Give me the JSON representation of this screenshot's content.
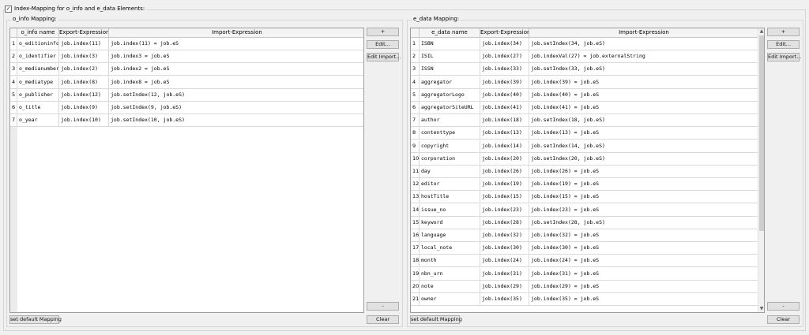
{
  "outer": {
    "title": "Index-Mapping for o_info and e_data Elements:",
    "checked": "✓"
  },
  "o_info": {
    "title": "o_info Mapping:",
    "headers": [
      "o_info name",
      "Export-Expression",
      "Import-Expression"
    ],
    "rows": [
      {
        "n": "1",
        "name": "o_editioninfo",
        "exp": "job.index(11)",
        "imp": "job.index(11) = job.eS"
      },
      {
        "n": "2",
        "name": "o_identifier",
        "exp": "job.index(3)",
        "imp": "job.index3 = job.eS"
      },
      {
        "n": "3",
        "name": "o_medianumber",
        "exp": "job.index(2)",
        "imp": "job.index2 = job.eS"
      },
      {
        "n": "4",
        "name": "o_mediatype",
        "exp": "job.index(8)",
        "imp": "job.index8 = job.eS"
      },
      {
        "n": "5",
        "name": "o_publisher",
        "exp": "job.index(12)",
        "imp": "job.setIndex(12, job.eS)"
      },
      {
        "n": "6",
        "name": "o_title",
        "exp": "job.index(9)",
        "imp": "job.setIndex(9, job.eS)"
      },
      {
        "n": "7",
        "name": "o_year",
        "exp": "job.index(10)",
        "imp": "job.setIndex(10, job.eS)"
      }
    ],
    "buttons": {
      "add": "+",
      "edit": "Edit...",
      "edit_import": "Edit Import...",
      "remove": "-",
      "default": "set default Mapping",
      "clear": "Clear"
    }
  },
  "e_data": {
    "title": "e_data Mapping:",
    "headers": [
      "e_data name",
      "Export-Expression",
      "Import-Expression"
    ],
    "rows": [
      {
        "n": "1",
        "name": "ISBN",
        "exp": "job.index(34)",
        "imp": "job.setIndex(34, job.eS)"
      },
      {
        "n": "2",
        "name": "ISIL",
        "exp": "job.index(27)",
        "imp": "job.indexVal(27) = job.externalString"
      },
      {
        "n": "3",
        "name": "ISSN",
        "exp": "job.index(33)",
        "imp": "job.setIndex(33, job.eS)"
      },
      {
        "n": "4",
        "name": "aggregator",
        "exp": "job.index(39)",
        "imp": "job.index(39) = job.eS"
      },
      {
        "n": "5",
        "name": "aggregatorLogo",
        "exp": "job.index(40)",
        "imp": "job.index(40) = job.eS"
      },
      {
        "n": "6",
        "name": "aggregatorSiteURL",
        "exp": "job.index(41)",
        "imp": "job.index(41) = job.eS"
      },
      {
        "n": "7",
        "name": "author",
        "exp": "job.index(18)",
        "imp": "job.setIndex(18, job.eS)"
      },
      {
        "n": "8",
        "name": "contenttype",
        "exp": "job.index(13)",
        "imp": "job.index(13) = job.eS"
      },
      {
        "n": "9",
        "name": "copyright",
        "exp": "job.index(14)",
        "imp": "job.setIndex(14, job.eS)"
      },
      {
        "n": "10",
        "name": "corporation",
        "exp": "job.index(20)",
        "imp": "job.setIndex(20, job.eS)"
      },
      {
        "n": "11",
        "name": "day",
        "exp": "job.index(26)",
        "imp": "job.index(26) = job.eS"
      },
      {
        "n": "12",
        "name": "editor",
        "exp": "job.index(19)",
        "imp": "job.index(19) = job.eS"
      },
      {
        "n": "13",
        "name": "hostTitle",
        "exp": "job.index(15)",
        "imp": "job.index(15) = job.eS"
      },
      {
        "n": "14",
        "name": "issue_no",
        "exp": "job.index(23)",
        "imp": "job.index(23) = job.eS"
      },
      {
        "n": "15",
        "name": "keyword",
        "exp": "job.index(28)",
        "imp": "job.setIndex(28, job.eS)"
      },
      {
        "n": "16",
        "name": "language",
        "exp": "job.index(32)",
        "imp": "job.index(32) = job.eS"
      },
      {
        "n": "17",
        "name": "local_note",
        "exp": "job.index(30)",
        "imp": "job.index(30) = job.eS"
      },
      {
        "n": "18",
        "name": "month",
        "exp": "job.index(24)",
        "imp": "job.index(24) = job.eS"
      },
      {
        "n": "19",
        "name": "nbn_urn",
        "exp": "job.index(31)",
        "imp": "job.index(31) = job.eS"
      },
      {
        "n": "20",
        "name": "note",
        "exp": "job.index(29)",
        "imp": "job.index(29) = job.eS"
      },
      {
        "n": "21",
        "name": "owner",
        "exp": "job.index(35)",
        "imp": "job.index(35) = job.eS"
      }
    ],
    "scroll_up": "▲",
    "scroll_down": "▼",
    "buttons": {
      "add": "+",
      "edit": "Edit...",
      "edit_import": "Edit Import...",
      "remove": "-",
      "default": "set default Mapping",
      "clear": "Clear"
    }
  }
}
